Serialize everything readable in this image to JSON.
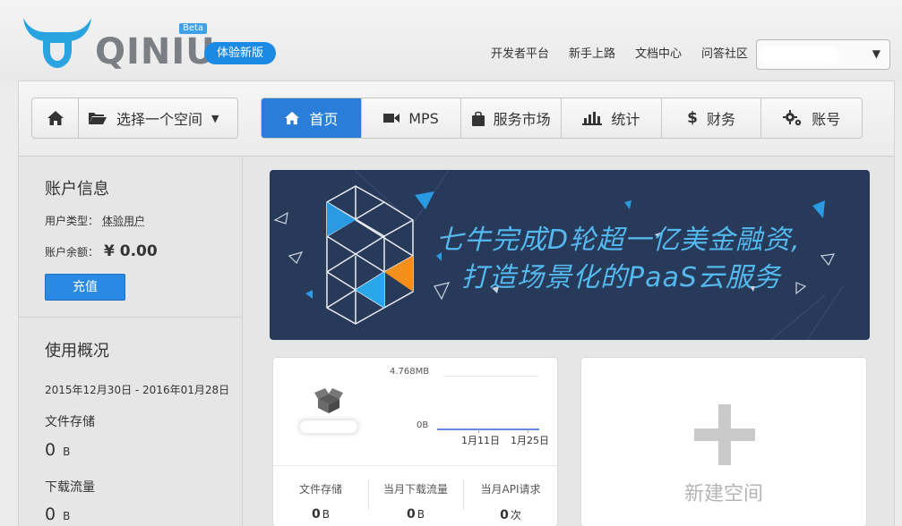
{
  "brand": {
    "name": "QINIU",
    "badge": "Beta"
  },
  "header": {
    "try_new": "体验新版",
    "links": [
      "开发者平台",
      "新手上路",
      "文档中心",
      "问答社区"
    ]
  },
  "toolbar": {
    "bucket_select": "选择一个空间",
    "nav": [
      {
        "label": "首页",
        "icon": "home-icon",
        "active": true
      },
      {
        "label": "MPS",
        "icon": "video-icon",
        "active": false
      },
      {
        "label": "服务市场",
        "icon": "shopping-bag-icon",
        "active": false
      },
      {
        "label": "统计",
        "icon": "bar-chart-icon",
        "active": false
      },
      {
        "label": "财务",
        "icon": "dollar-icon",
        "active": false
      },
      {
        "label": "账号",
        "icon": "gears-icon",
        "active": false
      }
    ]
  },
  "account": {
    "title": "账户信息",
    "type_label": "用户类型：",
    "type_value": "体验用户",
    "balance_label": "账户余额：",
    "balance_value": "¥ 0.00",
    "recharge": "充值"
  },
  "usage": {
    "title": "使用概况",
    "date_range": "2015年12月30日 - 2016年01月28日",
    "storage_label": "文件存储",
    "storage_value": "0",
    "storage_unit": "B",
    "traffic_label": "下载流量",
    "traffic_value": "0",
    "traffic_unit": "B"
  },
  "banner": {
    "line1": "七牛完成D轮超一亿美金融资,",
    "line2": "打造场景化的PaaS云服务"
  },
  "bucket_card": {
    "chart_max": "4.768MB",
    "chart_zero": "0B",
    "ticks": [
      "1月11日",
      "1月25日"
    ],
    "stats": [
      {
        "label": "文件存储",
        "value": "0",
        "unit": "B"
      },
      {
        "label": "当月下载流量",
        "value": "0",
        "unit": "B"
      },
      {
        "label": "当月API请求",
        "value": "0",
        "unit": "次"
      }
    ]
  },
  "new_bucket": {
    "label": "新建空间"
  },
  "colors": {
    "primary": "#2a7dd8",
    "banner_bg": "#283a5a",
    "banner_text": "#54b9ef",
    "accent_orange": "#f2901e"
  }
}
